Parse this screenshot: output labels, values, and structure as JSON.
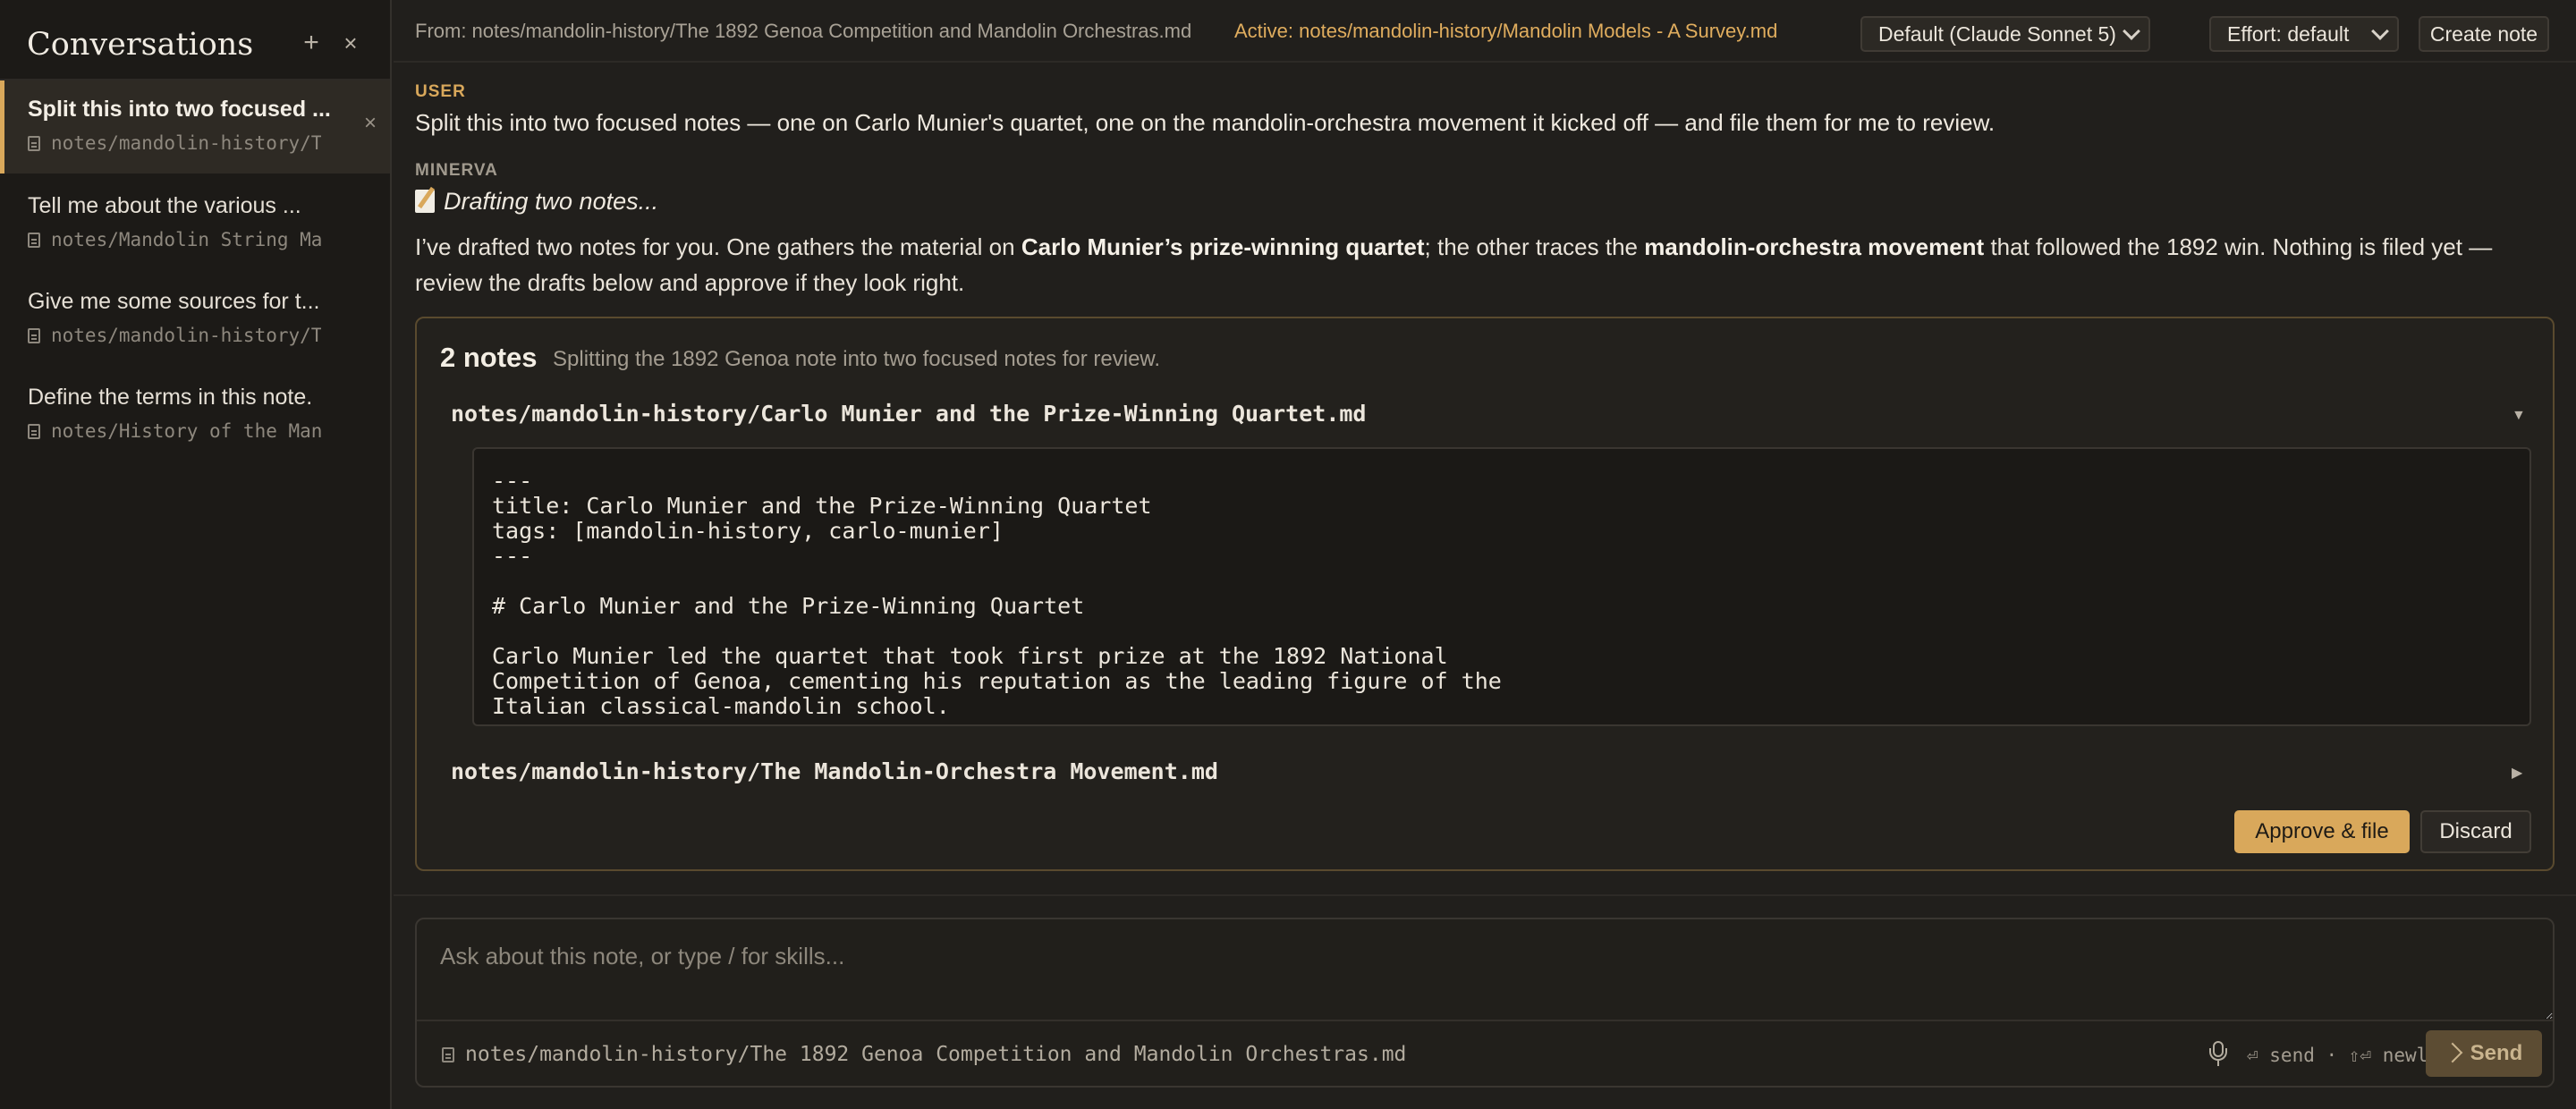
{
  "sidebar": {
    "title": "Conversations",
    "new_icon": "plus-icon",
    "close_icon": "close-icon",
    "items": [
      {
        "title": "Split this into two focused notes — one on Carlo Munier's quartet, one on the mandolin-orchestra movement it kicked off",
        "display_title": "Split this into two focused ...",
        "path": "notes/mandolin-history/T",
        "active": true
      },
      {
        "title": "Tell me about the various ...",
        "display_title": "Tell me about the various ...",
        "path": "notes/Mandolin String Ma",
        "active": false
      },
      {
        "title": "Give me some sources for t...",
        "display_title": "Give me some sources for t...",
        "path": "notes/mandolin-history/T",
        "active": false
      },
      {
        "title": "Define the terms in this note.",
        "display_title": "Define the terms in this note.",
        "path": "notes/History of the Man",
        "active": false
      }
    ]
  },
  "topbar": {
    "from_path": "From: notes/mandolin-history/The 1892 Genoa Competition and Mandolin Orchestras.md",
    "active_path": "Active: notes/mandolin-history/Mandolin Models - A Survey.md",
    "model": "Default (Claude Sonnet 5)",
    "effort": "Effort: default",
    "create_note": "Create note"
  },
  "conversation": {
    "user_label": "USER",
    "user_message": "Split this into two focused notes — one on Carlo Munier's quartet, one on the mandolin-orchestra movement it kicked off — and file them for me to review.",
    "assistant_label": "MINERVA",
    "status": "Drafting two notes...",
    "reply_part1": "I’ve drafted two notes for you. One gathers the material on ",
    "reply_bold1": "Carlo Munier’s prize-winning quartet",
    "reply_part2": "; the other traces the ",
    "reply_bold2": "mandolin-orchestra movement",
    "reply_part3": " that followed the 1892 win. Nothing is filed yet — review the drafts below and approve if they look right."
  },
  "notes_card": {
    "count": "2 notes",
    "description": "Splitting the 1892 Genoa note into two focused notes for review.",
    "notes": [
      {
        "path": "notes/mandolin-history/Carlo Munier and the Prize-Winning Quartet.md",
        "expanded": true,
        "body": "---\ntitle: Carlo Munier and the Prize-Winning Quartet\ntags: [mandolin-history, carlo-munier]\n---\n\n# Carlo Munier and the Prize-Winning Quartet\n\nCarlo Munier led the quartet that took first prize at the 1892 National\nCompetition of Genoa, cementing his reputation as the leading figure of the\nItalian classical-mandolin school."
      },
      {
        "path": "notes/mandolin-history/The Mandolin-Orchestra Movement.md",
        "expanded": false
      }
    ],
    "caret_open": "▼",
    "caret_closed": "▶",
    "approve": "Approve & file",
    "discard": "Discard"
  },
  "composer": {
    "placeholder": "Ask about this note, or type / for skills...",
    "context_path": "notes/mandolin-history/The 1892 Genoa Competition and Mandolin Orchestras.md",
    "shortcut_hint": "⏎ send · ⇧⏎ newline",
    "send": "Send"
  },
  "colors": {
    "accent": "#d9a85b",
    "background": "#211f1c",
    "sidebar": "#1c1a17"
  }
}
